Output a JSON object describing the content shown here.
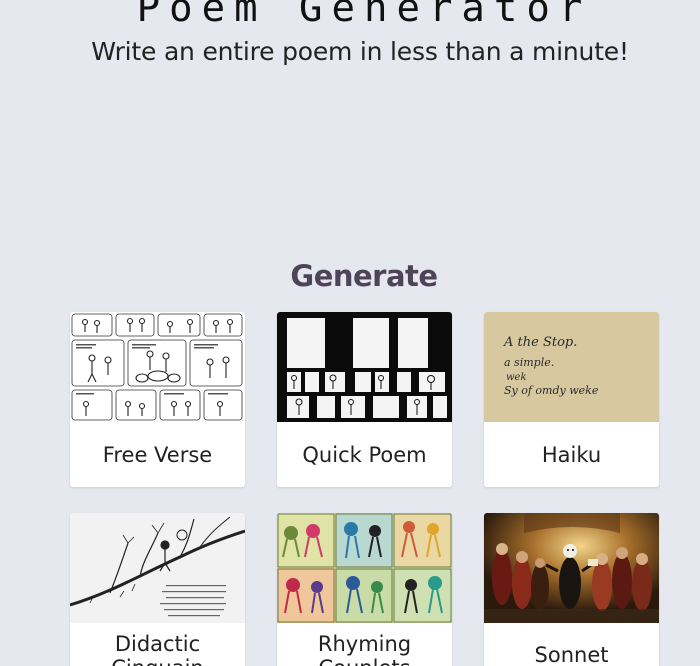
{
  "header": {
    "title": "Poem Generator",
    "subtitle": "Write an entire poem in less than a minute!"
  },
  "generate": {
    "heading": "Generate",
    "cards": [
      {
        "label": "Free Verse",
        "image": "comic-strip-sketch"
      },
      {
        "label": "Quick Poem",
        "image": "black-panel-comic"
      },
      {
        "label": "Haiku",
        "image": "handwritten-note-on-tan-paper"
      },
      {
        "label": "Didactic Cinquain",
        "image": "tree-branch-sketch"
      },
      {
        "label": "Rhyming Couplets",
        "image": "colorful-dancing-figures-grid"
      },
      {
        "label": "Sonnet",
        "image": "painted-crowd-scene"
      }
    ]
  },
  "haiku_note_text": [
    "A the Stop.",
    "a simple.",
    "wek",
    "Sy of omdy weke"
  ],
  "colors": {
    "background": "#e5e8ee",
    "heading_accent": "#4e4458",
    "card": "#ffffff",
    "haiku_paper": "#d8c8a0"
  }
}
